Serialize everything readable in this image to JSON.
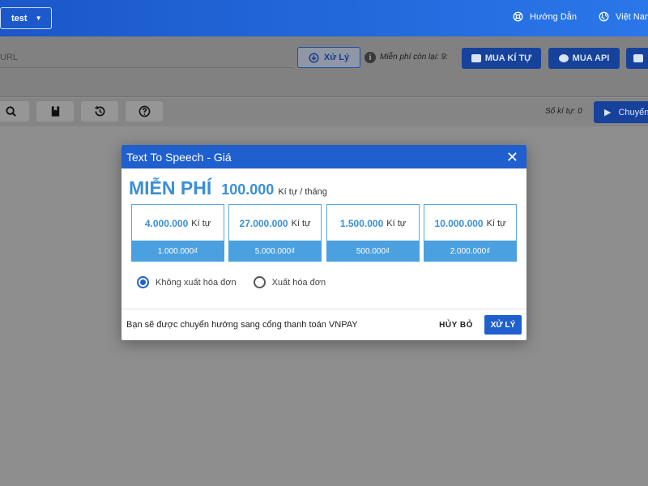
{
  "header": {
    "workspace": "test",
    "guide_label": "Hướng Dẫn",
    "language_label": "Việt Nam"
  },
  "url_bar": {
    "placeholder": "URL",
    "process_label": "Xử Lý",
    "free_remaining": "Miễn phí còn lại: 9:",
    "buy_chars_label": "MUA KÍ TỰ",
    "buy_api_label": "MUA API"
  },
  "toolbar": {
    "char_count": "Số kí tự: 0",
    "convert_label": "Chuyển"
  },
  "modal": {
    "title": "Text To Speech - Giá",
    "free_label": "MIỄN PHÍ",
    "free_amount": "100.000",
    "free_unit": "Kí tự / tháng",
    "packages": [
      {
        "amount": "4.000.000",
        "unit": "Kí tự",
        "price": "1.000.000₫"
      },
      {
        "amount": "27.000.000",
        "unit": "Kí tự",
        "price": "5.000.000₫"
      },
      {
        "amount": "1.500.000",
        "unit": "Kí tự",
        "price": "500.000₫"
      },
      {
        "amount": "10.000.000",
        "unit": "Kí tự",
        "price": "2.000.000₫"
      }
    ],
    "invoice_options": [
      {
        "label": "Không xuất hóa đơn",
        "selected": true
      },
      {
        "label": "Xuất hóa đơn",
        "selected": false
      }
    ],
    "note": "Bạn sẽ được chuyển hướng sang cổng thanh toán VNPAY",
    "cancel_label": "HỦY BỎ",
    "submit_label": "XỬ LÝ"
  },
  "colors": {
    "primary": "#1f5fce",
    "accent": "#3a8fd6",
    "package_footer": "#4ba0e0"
  }
}
